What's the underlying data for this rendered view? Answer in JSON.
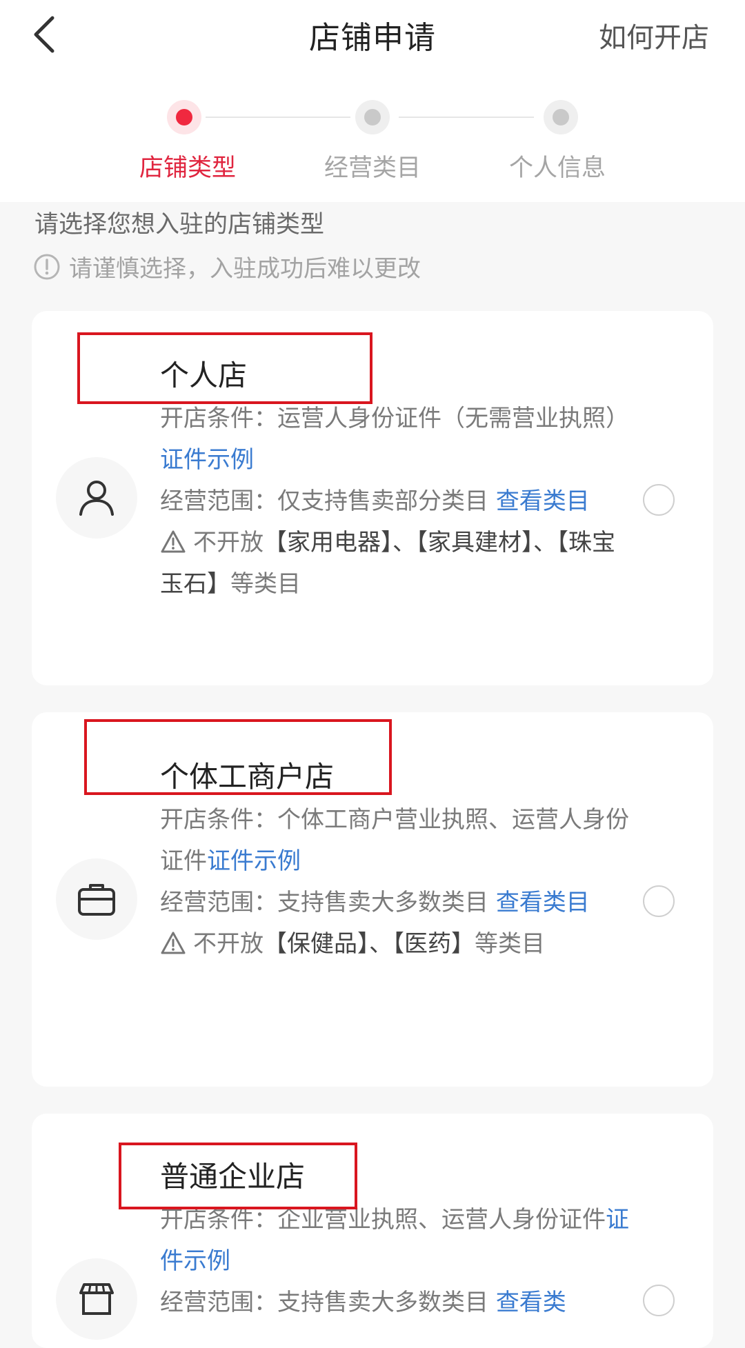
{
  "header": {
    "title": "店铺申请",
    "how_to_open": "如何开店"
  },
  "steps": [
    {
      "label": "店铺类型",
      "state": "active"
    },
    {
      "label": "经营类目",
      "state": "inactive"
    },
    {
      "label": "个人信息",
      "state": "inactive"
    }
  ],
  "intro": {
    "title": "请选择您想入驻的店铺类型",
    "warning": "请谨慎选择，入驻成功后难以更改"
  },
  "cards": [
    {
      "title": "个人店",
      "icon": "person-icon",
      "condition_text": "开店条件：运营人身份证件（无需营业执照）",
      "condition_link": "证件示例",
      "scope_text": "经营范围：仅支持售卖部分类目 ",
      "scope_link": "查看类目",
      "restrict_prefix": "不开放",
      "restrict_items": "【家用电器】、【家具建材】、【珠宝玉石】",
      "restrict_suffix": "等类目"
    },
    {
      "title": "个体工商户店",
      "icon": "briefcase-icon",
      "condition_text": "开店条件：个体工商户营业执照、运营人身份证件",
      "condition_link": "证件示例",
      "scope_text": "经营范围：支持售卖大多数类目 ",
      "scope_link": "查看类目",
      "restrict_prefix": "不开放",
      "restrict_items": "【保健品】、【医药】",
      "restrict_suffix": "等类目"
    },
    {
      "title": "普通企业店",
      "icon": "storefront-icon",
      "condition_text": "开店条件：企业营业执照、运营人身份证件",
      "condition_link": "证件示例",
      "scope_text": "经营范围：支持售卖大多数类目 ",
      "scope_link": "查看类"
    }
  ],
  "colors": {
    "accent": "#f0283f",
    "link": "#3a7bd0",
    "annotation": "#d9161f"
  }
}
